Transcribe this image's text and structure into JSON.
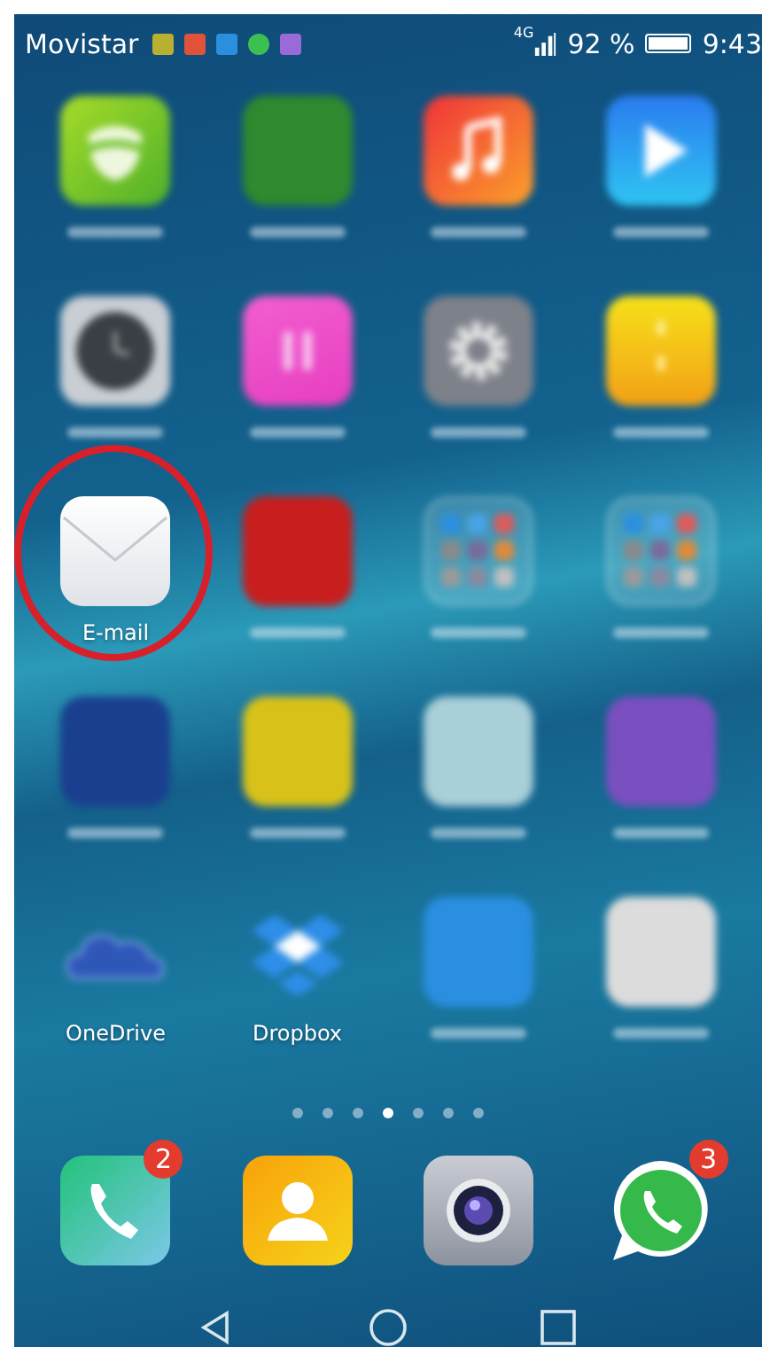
{
  "status_bar": {
    "carrier": "Movistar",
    "notifications": [
      {
        "kind": "cleaner"
      },
      {
        "kind": "missed-call"
      },
      {
        "kind": "message"
      },
      {
        "kind": "whatsapp"
      },
      {
        "kind": "gallery"
      }
    ],
    "network": "4G",
    "battery": "92 %",
    "time": "9:43"
  },
  "apps": [
    {
      "kind": "phone-manager",
      "highlighted": false
    },
    {
      "kind": "tile",
      "color": "#2e8a2e",
      "highlighted": false
    },
    {
      "kind": "music",
      "highlighted": false
    },
    {
      "kind": "video",
      "highlighted": false
    },
    {
      "kind": "clock",
      "highlighted": false
    },
    {
      "kind": "calendar",
      "highlighted": false
    },
    {
      "kind": "settings",
      "highlighted": false
    },
    {
      "kind": "files",
      "highlighted": false
    },
    {
      "kind": "email",
      "label": "E-mail",
      "highlighted": true
    },
    {
      "kind": "tile",
      "color": "#c81e1e",
      "highlighted": false
    },
    {
      "kind": "folder",
      "highlighted": false
    },
    {
      "kind": "folder",
      "highlighted": false
    },
    {
      "kind": "tile",
      "color": "#1a3f8f",
      "highlighted": false
    },
    {
      "kind": "tile",
      "color": "#d8c21a",
      "highlighted": false
    },
    {
      "kind": "tile",
      "color": "#a9cfd8",
      "highlighted": false
    },
    {
      "kind": "tile",
      "color": "#7a4fc0",
      "highlighted": false
    },
    {
      "kind": "onedrive",
      "label": "OneDrive",
      "highlighted": false
    },
    {
      "kind": "dropbox",
      "label": "Dropbox",
      "highlighted": false
    },
    {
      "kind": "tile",
      "color": "#2a8fe0",
      "highlighted": false
    },
    {
      "kind": "tile",
      "color": "#dcdcdc",
      "highlighted": false
    }
  ],
  "page_dots": [
    {
      "selected": false
    },
    {
      "selected": false
    },
    {
      "selected": false
    },
    {
      "selected": true
    },
    {
      "selected": false
    },
    {
      "selected": false
    },
    {
      "selected": false
    }
  ],
  "dock": [
    {
      "kind": "phone",
      "badge": "2"
    },
    {
      "kind": "contacts"
    },
    {
      "kind": "camera"
    },
    {
      "kind": "whatsapp",
      "badge": "3"
    }
  ],
  "nav_buttons": [
    {
      "kind": "back"
    },
    {
      "kind": "home"
    },
    {
      "kind": "recents"
    }
  ]
}
